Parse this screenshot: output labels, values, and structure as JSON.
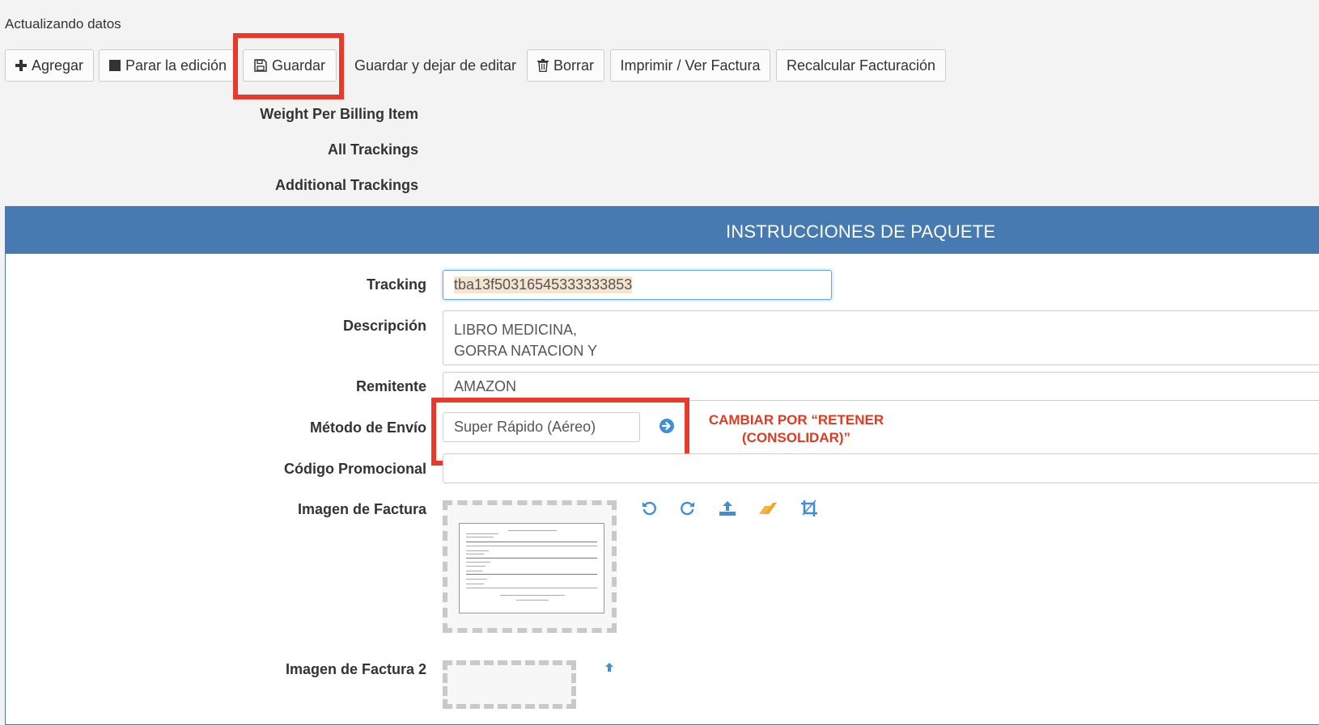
{
  "status_text": "Actualizando datos",
  "toolbar": {
    "add": "Agregar",
    "stop_edit": "Parar la edición",
    "save": "Guardar",
    "save_exit": "Guardar y dejar de editar",
    "delete": "Borrar",
    "print": "Imprimir / Ver Factura",
    "recalc": "Recalcular Facturación"
  },
  "meta_labels": {
    "weight": "Weight Per Billing Item",
    "all_trackings": "All Trackings",
    "additional_trackings": "Additional Trackings"
  },
  "panel": {
    "title": "INSTRUCCIONES DE PAQUETE",
    "tracking_label": "Tracking",
    "tracking_value": "tba13f50316545333333853",
    "description_label": "Descripción",
    "description_line1": "LIBRO MEDICINA,",
    "description_line2": "GORRA NATACION Y",
    "sender_label": "Remitente",
    "sender_value": "AMAZON",
    "shipping_label": "Método de Envío",
    "shipping_value": "Super Rápido (Aéreo)",
    "promo_label": "Código Promocional",
    "promo_value": "",
    "invoice_label": "Imagen de Factura",
    "invoice2_label": "Imagen de Factura 2"
  },
  "annotation": {
    "line1": "CAMBIAR POR “RETENER",
    "line2": "(CONSOLIDAR)”"
  },
  "colors": {
    "accent": "#467ab1",
    "highlight": "#e8392a",
    "icon_blue": "#3f8fd8",
    "eraser": "#f5a623"
  }
}
